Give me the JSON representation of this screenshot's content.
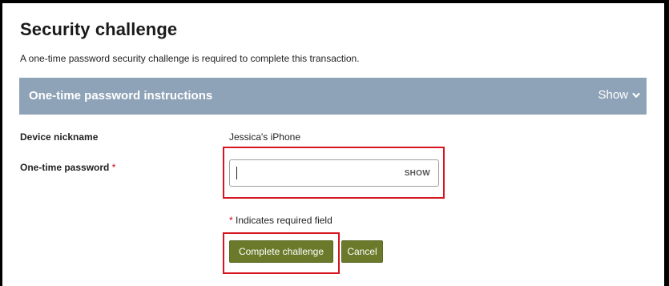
{
  "page": {
    "title": "Security challenge",
    "subtitle": "A one-time password security challenge is required to complete this transaction."
  },
  "instructions_panel": {
    "title": "One-time password instructions",
    "toggle_label": "Show",
    "toggle_icon": "chevron-down-icon"
  },
  "form": {
    "device_nickname_label": "Device nickname",
    "device_nickname_value": "Jessica's iPhone",
    "otp_label": "One-time password",
    "required_marker": "*",
    "otp_value": "",
    "otp_show_label": "SHOW",
    "required_note": "Indicates required field"
  },
  "actions": {
    "complete_label": "Complete challenge",
    "cancel_label": "Cancel"
  },
  "colors": {
    "panel_bg": "#8fa3b8",
    "button_bg": "#6b7a2a",
    "required": "#d0021b",
    "highlight": "#d7151e"
  }
}
